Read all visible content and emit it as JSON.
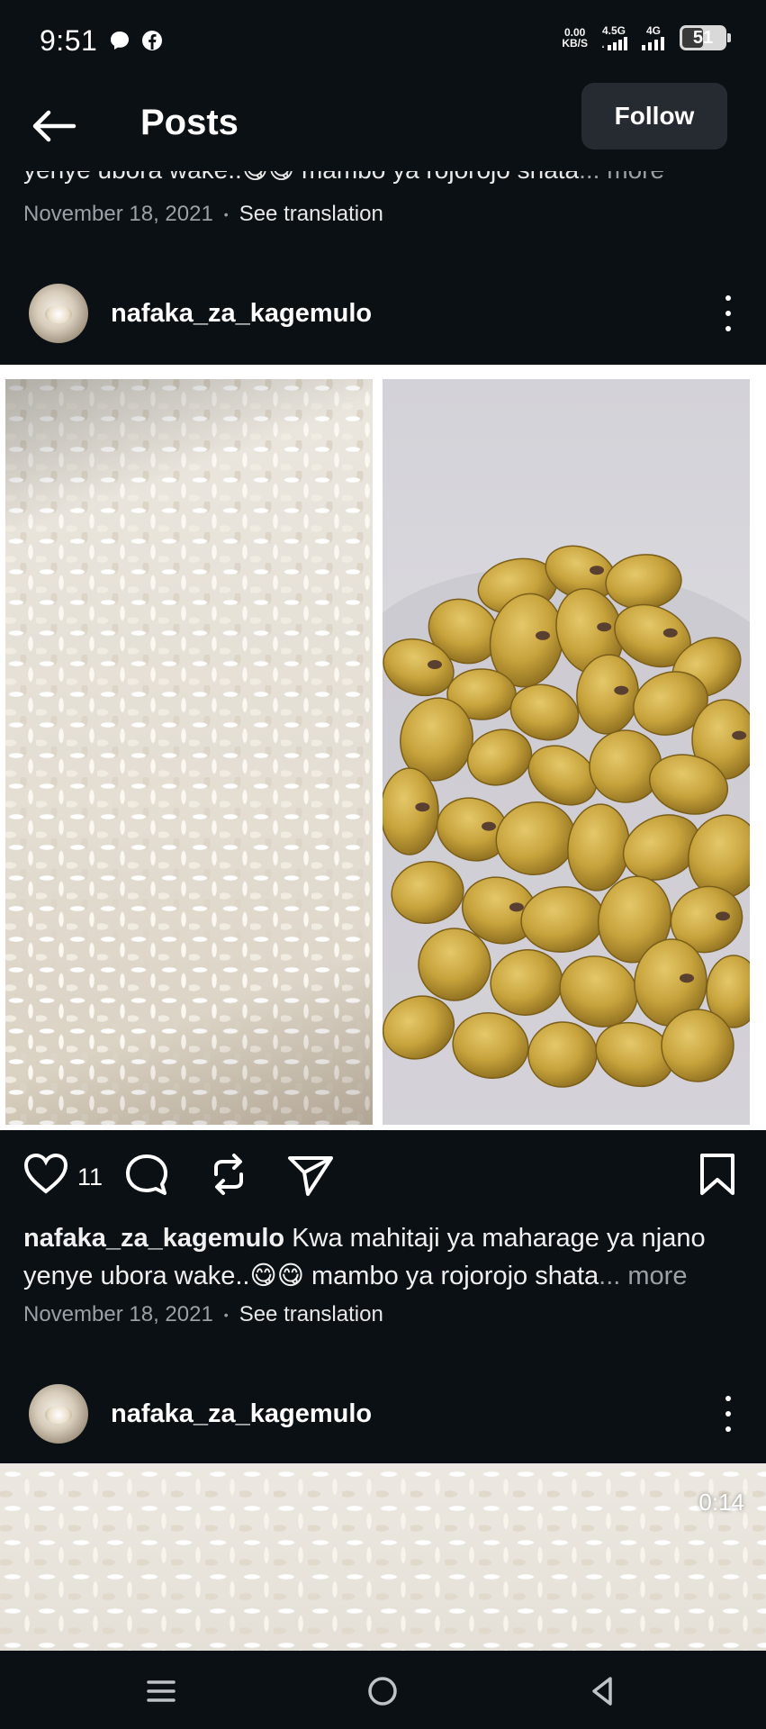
{
  "status_bar": {
    "time": "9:51",
    "net_speed_value": "0.00",
    "net_speed_unit": "KB/S",
    "signal_1_label": "4.5G",
    "signal_2_label": "4G",
    "battery": "51",
    "battery_level_percent": 51
  },
  "header": {
    "title": "Posts",
    "follow_label": "Follow"
  },
  "previous_post": {
    "caption_fragment": "yenye ubora wake..😋😋 mambo ya rojorojo shata",
    "more_label": "... more",
    "date": "November 18, 2021",
    "separator": "•",
    "translate_label": "See translation"
  },
  "post": {
    "username": "nafaka_za_kagemulo",
    "like_count": "11",
    "caption_text": " Kwa mahitaji ya maharage ya njano yenye ubora wake..😋😋 mambo ya rojorojo shata",
    "more_label": "... more",
    "date": "November 18, 2021",
    "separator": "•",
    "translate_label": "See translation"
  },
  "next_post": {
    "username": "nafaka_za_kagemulo",
    "video_duration": "0:14"
  },
  "colors": {
    "background": "#0b1014",
    "follow_button": "#262b31",
    "muted_text": "#9aa0a6"
  },
  "icons": [
    "back-arrow-icon",
    "messenger-icon",
    "facebook-icon",
    "heart-icon",
    "comment-icon",
    "repost-icon",
    "share-icon",
    "bookmark-icon",
    "more-icon",
    "menu-icon",
    "home-icon",
    "back-icon"
  ]
}
